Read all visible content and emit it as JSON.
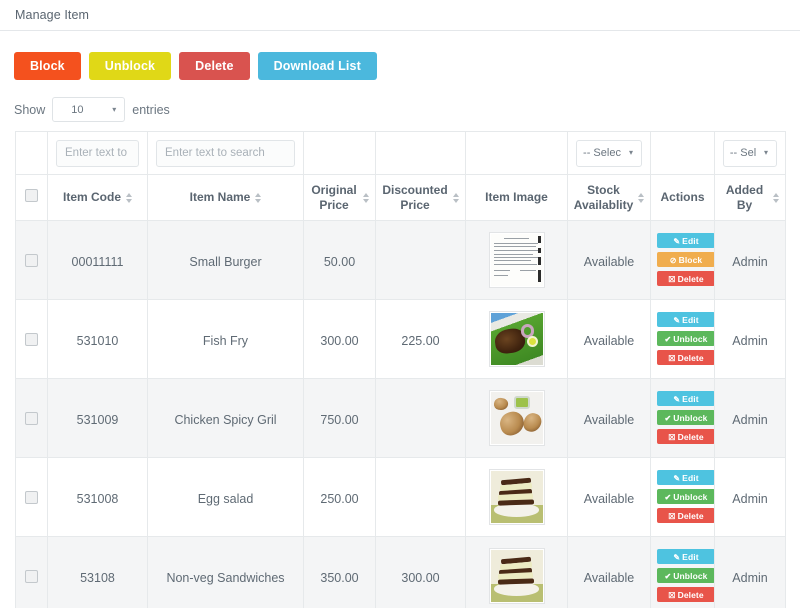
{
  "header": {
    "title": "Manage Item"
  },
  "toolbar": {
    "block_label": "Block",
    "unblock_label": "Unblock",
    "delete_label": "Delete",
    "download_label": "Download List"
  },
  "length_menu": {
    "show_label": "Show",
    "entries_label": "entries",
    "value": "10",
    "caret": "▾"
  },
  "filters": {
    "item_code_placeholder": "Enter text to search",
    "item_name_placeholder": "Enter text to search",
    "stock_select": "-- Selec",
    "added_by_select": "-- Sel",
    "caret": "▾"
  },
  "table": {
    "columns": [
      {
        "key": "select",
        "label": "",
        "sortable": false
      },
      {
        "key": "code",
        "label": "Item Code",
        "sortable": true
      },
      {
        "key": "name",
        "label": "Item Name",
        "sortable": true
      },
      {
        "key": "original",
        "label": "Original Price",
        "sortable": true
      },
      {
        "key": "discount",
        "label": "Discounted Price",
        "sortable": true
      },
      {
        "key": "image",
        "label": "Item Image",
        "sortable": false
      },
      {
        "key": "stock",
        "label": "Stock Availablity",
        "sortable": true
      },
      {
        "key": "actions",
        "label": "Actions",
        "sortable": false
      },
      {
        "key": "added",
        "label": "Added By",
        "sortable": true
      }
    ],
    "rows": [
      {
        "code": "00011111",
        "name": "Small Burger",
        "original": "50.00",
        "discount": "",
        "image": "document-scan-thumbnail",
        "stock": "Available",
        "added_by": "Admin",
        "actions": [
          "Edit",
          "Block",
          "Delete"
        ]
      },
      {
        "code": "531010",
        "name": "Fish Fry",
        "original": "300.00",
        "discount": "225.00",
        "image": "fish-fry-thumbnail",
        "stock": "Available",
        "added_by": "Admin",
        "actions": [
          "Edit",
          "Unblock",
          "Delete"
        ]
      },
      {
        "code": "531009",
        "name": "Chicken Spicy Gril",
        "original": "750.00",
        "discount": "",
        "image": "chicken-grill-thumbnail",
        "stock": "Available",
        "added_by": "Admin",
        "actions": [
          "Edit",
          "Unblock",
          "Delete"
        ]
      },
      {
        "code": "531008",
        "name": "Egg salad",
        "original": "250.00",
        "discount": "",
        "image": "sandwich-thumbnail",
        "stock": "Available",
        "added_by": "Admin",
        "actions": [
          "Edit",
          "Unblock",
          "Delete"
        ]
      },
      {
        "code": "53108",
        "name": "Non-veg Sandwiches",
        "original": "350.00",
        "discount": "300.00",
        "image": "sandwich-thumbnail",
        "stock": "Available",
        "added_by": "Admin",
        "actions": [
          "Edit",
          "Unblock",
          "Delete"
        ]
      }
    ]
  },
  "colors": {
    "block": "#f4511e",
    "unblock": "#e0d817",
    "delete": "#d9534f",
    "download": "#4bb8dd",
    "action_edit": "#4ec3e0",
    "action_block": "#f0ad4e",
    "action_unblock": "#5cb85c",
    "action_delete": "#e8544a"
  }
}
